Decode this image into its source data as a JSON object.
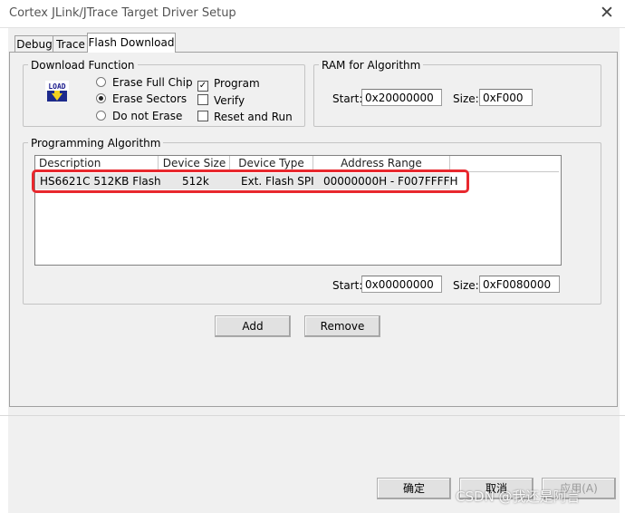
{
  "window": {
    "title": "Cortex JLink/JTrace Target Driver Setup"
  },
  "tabs": [
    {
      "label": "Debug"
    },
    {
      "label": "Trace"
    },
    {
      "label": "Flash Download"
    }
  ],
  "download_function": {
    "legend": "Download Function",
    "icon_text": "LOAD",
    "erase_options": [
      {
        "label": "Erase Full Chip",
        "selected": false
      },
      {
        "label": "Erase Sectors",
        "selected": true
      },
      {
        "label": "Do not Erase",
        "selected": false
      }
    ],
    "checks": [
      {
        "label": "Program",
        "checked": true
      },
      {
        "label": "Verify",
        "checked": false
      },
      {
        "label": "Reset and Run",
        "checked": false
      }
    ]
  },
  "ram": {
    "legend": "RAM for Algorithm",
    "start_label": "Start:",
    "start_value": "0x20000000",
    "size_label": "Size:",
    "size_value": "0xF000"
  },
  "programming": {
    "legend": "Programming Algorithm",
    "columns": [
      "Description",
      "Device Size",
      "Device Type",
      "Address Range"
    ],
    "rows": [
      {
        "description": "HS6621C 512KB Flash",
        "size": "512k",
        "type": "Ext. Flash SPI",
        "range": "00000000H - F007FFFFH"
      }
    ],
    "start_label": "Start:",
    "start_value": "0x00000000",
    "size_label": "Size:",
    "size_value": "0xF0080000"
  },
  "buttons": {
    "add": "Add",
    "remove": "Remove",
    "ok": "确定",
    "cancel": "取消",
    "apply": "应用(A)"
  },
  "watermark": "CSDN @我还是阿言",
  "colors": {
    "highlight": "#e8282e",
    "panel": "#f0f0f0"
  }
}
